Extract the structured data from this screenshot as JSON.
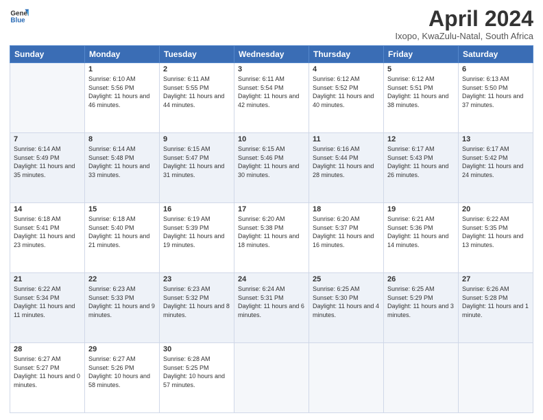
{
  "logo": {
    "line1": "General",
    "line2": "Blue"
  },
  "title": "April 2024",
  "subtitle": "Ixopo, KwaZulu-Natal, South Africa",
  "weekdays": [
    "Sunday",
    "Monday",
    "Tuesday",
    "Wednesday",
    "Thursday",
    "Friday",
    "Saturday"
  ],
  "weeks": [
    [
      {
        "day": "",
        "sunrise": "",
        "sunset": "",
        "daylight": ""
      },
      {
        "day": "1",
        "sunrise": "Sunrise: 6:10 AM",
        "sunset": "Sunset: 5:56 PM",
        "daylight": "Daylight: 11 hours and 46 minutes."
      },
      {
        "day": "2",
        "sunrise": "Sunrise: 6:11 AM",
        "sunset": "Sunset: 5:55 PM",
        "daylight": "Daylight: 11 hours and 44 minutes."
      },
      {
        "day": "3",
        "sunrise": "Sunrise: 6:11 AM",
        "sunset": "Sunset: 5:54 PM",
        "daylight": "Daylight: 11 hours and 42 minutes."
      },
      {
        "day": "4",
        "sunrise": "Sunrise: 6:12 AM",
        "sunset": "Sunset: 5:52 PM",
        "daylight": "Daylight: 11 hours and 40 minutes."
      },
      {
        "day": "5",
        "sunrise": "Sunrise: 6:12 AM",
        "sunset": "Sunset: 5:51 PM",
        "daylight": "Daylight: 11 hours and 38 minutes."
      },
      {
        "day": "6",
        "sunrise": "Sunrise: 6:13 AM",
        "sunset": "Sunset: 5:50 PM",
        "daylight": "Daylight: 11 hours and 37 minutes."
      }
    ],
    [
      {
        "day": "7",
        "sunrise": "Sunrise: 6:14 AM",
        "sunset": "Sunset: 5:49 PM",
        "daylight": "Daylight: 11 hours and 35 minutes."
      },
      {
        "day": "8",
        "sunrise": "Sunrise: 6:14 AM",
        "sunset": "Sunset: 5:48 PM",
        "daylight": "Daylight: 11 hours and 33 minutes."
      },
      {
        "day": "9",
        "sunrise": "Sunrise: 6:15 AM",
        "sunset": "Sunset: 5:47 PM",
        "daylight": "Daylight: 11 hours and 31 minutes."
      },
      {
        "day": "10",
        "sunrise": "Sunrise: 6:15 AM",
        "sunset": "Sunset: 5:46 PM",
        "daylight": "Daylight: 11 hours and 30 minutes."
      },
      {
        "day": "11",
        "sunrise": "Sunrise: 6:16 AM",
        "sunset": "Sunset: 5:44 PM",
        "daylight": "Daylight: 11 hours and 28 minutes."
      },
      {
        "day": "12",
        "sunrise": "Sunrise: 6:17 AM",
        "sunset": "Sunset: 5:43 PM",
        "daylight": "Daylight: 11 hours and 26 minutes."
      },
      {
        "day": "13",
        "sunrise": "Sunrise: 6:17 AM",
        "sunset": "Sunset: 5:42 PM",
        "daylight": "Daylight: 11 hours and 24 minutes."
      }
    ],
    [
      {
        "day": "14",
        "sunrise": "Sunrise: 6:18 AM",
        "sunset": "Sunset: 5:41 PM",
        "daylight": "Daylight: 11 hours and 23 minutes."
      },
      {
        "day": "15",
        "sunrise": "Sunrise: 6:18 AM",
        "sunset": "Sunset: 5:40 PM",
        "daylight": "Daylight: 11 hours and 21 minutes."
      },
      {
        "day": "16",
        "sunrise": "Sunrise: 6:19 AM",
        "sunset": "Sunset: 5:39 PM",
        "daylight": "Daylight: 11 hours and 19 minutes."
      },
      {
        "day": "17",
        "sunrise": "Sunrise: 6:20 AM",
        "sunset": "Sunset: 5:38 PM",
        "daylight": "Daylight: 11 hours and 18 minutes."
      },
      {
        "day": "18",
        "sunrise": "Sunrise: 6:20 AM",
        "sunset": "Sunset: 5:37 PM",
        "daylight": "Daylight: 11 hours and 16 minutes."
      },
      {
        "day": "19",
        "sunrise": "Sunrise: 6:21 AM",
        "sunset": "Sunset: 5:36 PM",
        "daylight": "Daylight: 11 hours and 14 minutes."
      },
      {
        "day": "20",
        "sunrise": "Sunrise: 6:22 AM",
        "sunset": "Sunset: 5:35 PM",
        "daylight": "Daylight: 11 hours and 13 minutes."
      }
    ],
    [
      {
        "day": "21",
        "sunrise": "Sunrise: 6:22 AM",
        "sunset": "Sunset: 5:34 PM",
        "daylight": "Daylight: 11 hours and 11 minutes."
      },
      {
        "day": "22",
        "sunrise": "Sunrise: 6:23 AM",
        "sunset": "Sunset: 5:33 PM",
        "daylight": "Daylight: 11 hours and 9 minutes."
      },
      {
        "day": "23",
        "sunrise": "Sunrise: 6:23 AM",
        "sunset": "Sunset: 5:32 PM",
        "daylight": "Daylight: 11 hours and 8 minutes."
      },
      {
        "day": "24",
        "sunrise": "Sunrise: 6:24 AM",
        "sunset": "Sunset: 5:31 PM",
        "daylight": "Daylight: 11 hours and 6 minutes."
      },
      {
        "day": "25",
        "sunrise": "Sunrise: 6:25 AM",
        "sunset": "Sunset: 5:30 PM",
        "daylight": "Daylight: 11 hours and 4 minutes."
      },
      {
        "day": "26",
        "sunrise": "Sunrise: 6:25 AM",
        "sunset": "Sunset: 5:29 PM",
        "daylight": "Daylight: 11 hours and 3 minutes."
      },
      {
        "day": "27",
        "sunrise": "Sunrise: 6:26 AM",
        "sunset": "Sunset: 5:28 PM",
        "daylight": "Daylight: 11 hours and 1 minute."
      }
    ],
    [
      {
        "day": "28",
        "sunrise": "Sunrise: 6:27 AM",
        "sunset": "Sunset: 5:27 PM",
        "daylight": "Daylight: 11 hours and 0 minutes."
      },
      {
        "day": "29",
        "sunrise": "Sunrise: 6:27 AM",
        "sunset": "Sunset: 5:26 PM",
        "daylight": "Daylight: 10 hours and 58 minutes."
      },
      {
        "day": "30",
        "sunrise": "Sunrise: 6:28 AM",
        "sunset": "Sunset: 5:25 PM",
        "daylight": "Daylight: 10 hours and 57 minutes."
      },
      {
        "day": "",
        "sunrise": "",
        "sunset": "",
        "daylight": ""
      },
      {
        "day": "",
        "sunrise": "",
        "sunset": "",
        "daylight": ""
      },
      {
        "day": "",
        "sunrise": "",
        "sunset": "",
        "daylight": ""
      },
      {
        "day": "",
        "sunrise": "",
        "sunset": "",
        "daylight": ""
      }
    ]
  ]
}
